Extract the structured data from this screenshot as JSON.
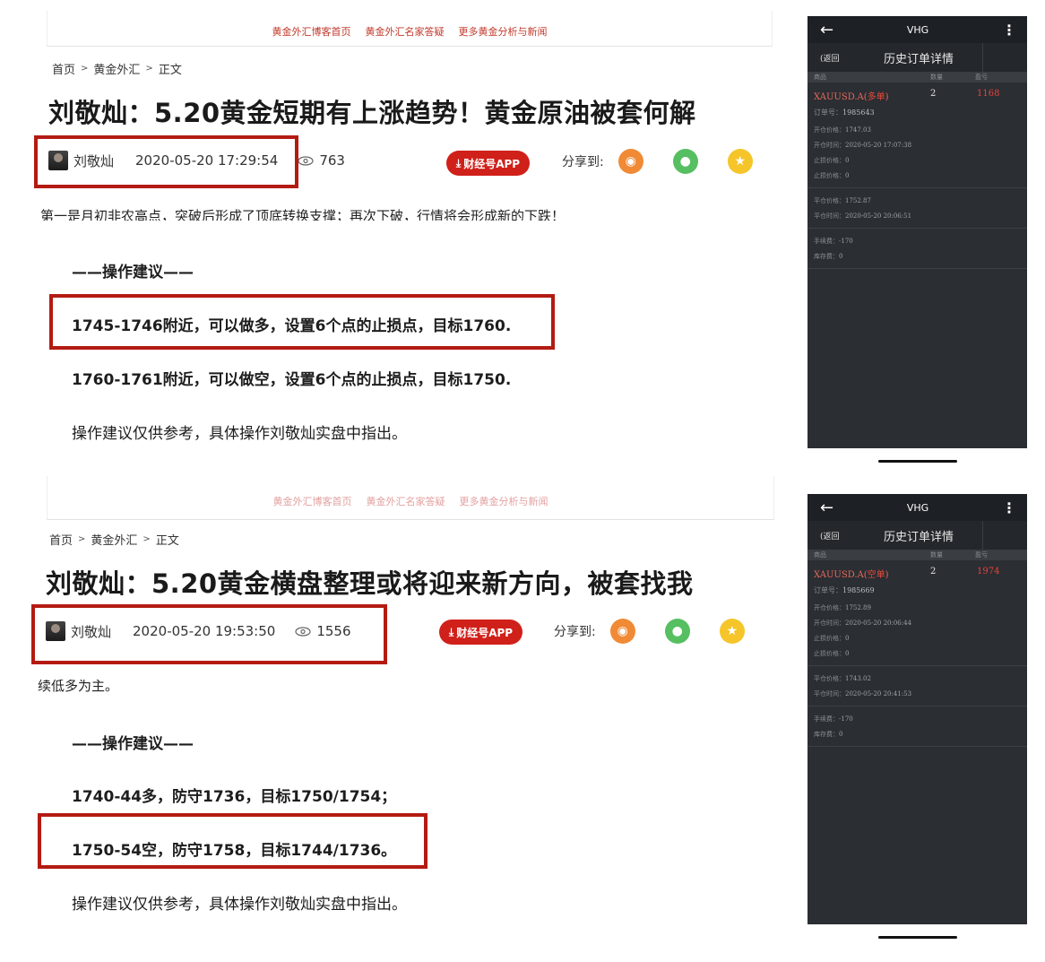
{
  "articles": [
    {
      "nav": [
        "黄金外汇博客首页",
        "黄金外汇名家答疑",
        "更多黄金分析与新闻"
      ],
      "breadcrumb": [
        "首页",
        "黄金外汇",
        "正文"
      ],
      "title": "刘敬灿：5.20黄金短期有上涨趋势！黄金原油被套何解",
      "author": "刘敬灿",
      "date": "2020-05-20 17:29:54",
      "views": "763",
      "app_button": "财经号APP",
      "share_label": "分享到:",
      "partial_text": "第一是月初非农高点，突破后形成了顶底转换支撑；再次下破，行情将会形成新的下跌！",
      "section_heading": "——操作建议——",
      "advice1": "1745-1746附近，可以做多，设置6个点的止损点，目标1760.",
      "advice2": "1760-1761附近，可以做空，设置6个点的止损点，目标1750.",
      "disclaimer": "操作建议仅供参考，具体操作刘敬灿实盘中指出。"
    },
    {
      "nav": [
        "黄金外汇博客首页",
        "黄金外汇名家答疑",
        "更多黄金分析与新闻"
      ],
      "breadcrumb": [
        "首页",
        "黄金外汇",
        "正文"
      ],
      "title": "刘敬灿：5.20黄金横盘整理或将迎来新方向，被套找我",
      "author": "刘敬灿",
      "date": "2020-05-20 19:53:50",
      "views": "1556",
      "app_button": "财经号APP",
      "share_label": "分享到:",
      "partial_text": "续低多为主。",
      "section_heading": "——操作建议——",
      "advice1": "1740-44多，防守1736，目标1750/1754；",
      "advice2": "1750-54空，防守1758，目标1744/1736。",
      "disclaimer": "操作建议仅供参考，具体操作刘敬灿实盘中指出。"
    }
  ],
  "phones": [
    {
      "app_title": "VHG",
      "back": "(返回",
      "page_title": "历史订单详情",
      "col_headers": [
        "商品",
        "数量",
        "盈亏"
      ],
      "symbol": "XAUUSD.A(",
      "order_type": "多单",
      "symbol_close": ")",
      "quantity": "2",
      "profit": "1168",
      "order_no_label": "订单号：",
      "order_no": "1985643",
      "open_price_label": "开仓价格：",
      "open_price": "1747.03",
      "open_time_label": "开仓时间：",
      "open_time": "2020-05-20 17:07:38",
      "sl_label": "止损价格：",
      "sl": "0",
      "tp_label": "止损价格：",
      "tp": "0",
      "close_price_label": "平仓价格：",
      "close_price": "1752.87",
      "close_time_label": "平仓时间：",
      "close_time": "2020-05-20 20:06:51",
      "fee_label": "手续费：",
      "fee": "-170",
      "swap_label": "库存费：",
      "swap": "0"
    },
    {
      "app_title": "VHG",
      "back": "(返回",
      "page_title": "历史订单详情",
      "col_headers": [
        "商品",
        "数量",
        "盈亏"
      ],
      "symbol": "XAUUSD.A(",
      "order_type": "空单",
      "symbol_close": ")",
      "quantity": "2",
      "profit": "1974",
      "order_no_label": "订单号：",
      "order_no": "1985669",
      "open_price_label": "开仓价格：",
      "open_price": "1752.89",
      "open_time_label": "开仓时间：",
      "open_time": "2020-05-20 20:06:44",
      "sl_label": "止损价格：",
      "sl": "0",
      "tp_label": "止损价格：",
      "tp": "0",
      "close_price_label": "平仓价格：",
      "close_price": "1743.02",
      "close_time_label": "平仓时间：",
      "close_time": "2020-05-20 20:41:53",
      "fee_label": "手续费：",
      "fee": "-170",
      "swap_label": "库存费：",
      "swap": "0"
    }
  ]
}
